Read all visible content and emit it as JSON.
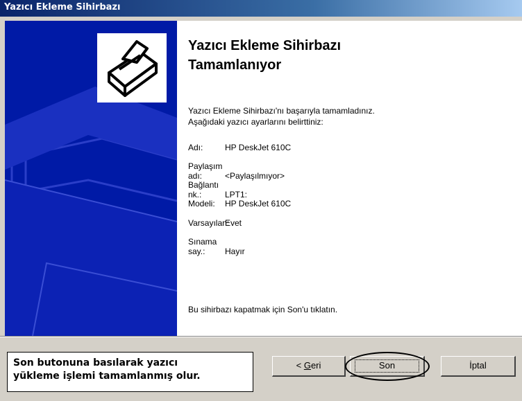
{
  "window": {
    "title": "Yazıcı Ekleme Sihirbazı"
  },
  "content": {
    "heading": "Yazıcı Ekleme Sihirbazı\nTamamlanıyor",
    "intro_line1": "Yazıcı Ekleme Sihirbazı'nı başarıyla tamamladınız.",
    "intro_line2": "Aşağıdaki yazıcı ayarlarını belirttiniz:",
    "settings": [
      {
        "key": "Adı:",
        "value": "HP DeskJet 610C"
      },
      {
        "key": "Paylaşım adı:",
        "value": "<Paylaşılmıyor>"
      },
      {
        "key": "Bağlantı nk.:",
        "value": "LPT1:"
      },
      {
        "key": "Modeli:",
        "value": "HP DeskJet 610C"
      },
      {
        "key": "Varsayılan:",
        "value": "Evet"
      },
      {
        "key": "Sınama say.:",
        "value": "Hayır"
      }
    ],
    "footer_note": "Bu sihirbazı kapatmak için Son'u tıklatın."
  },
  "callout": {
    "line1": "Son butonuna basılarak yazıcı",
    "line2": "yükleme işlemi tamamlanmış olur."
  },
  "buttons": {
    "back_prefix": "< ",
    "back_accel": "G",
    "back_rest": "eri",
    "finish": "Son",
    "cancel": "İptal"
  },
  "icons": {
    "banner": "printer-icon"
  },
  "colors": {
    "banner": "#001aa6",
    "titlebar": "#0a246a"
  }
}
